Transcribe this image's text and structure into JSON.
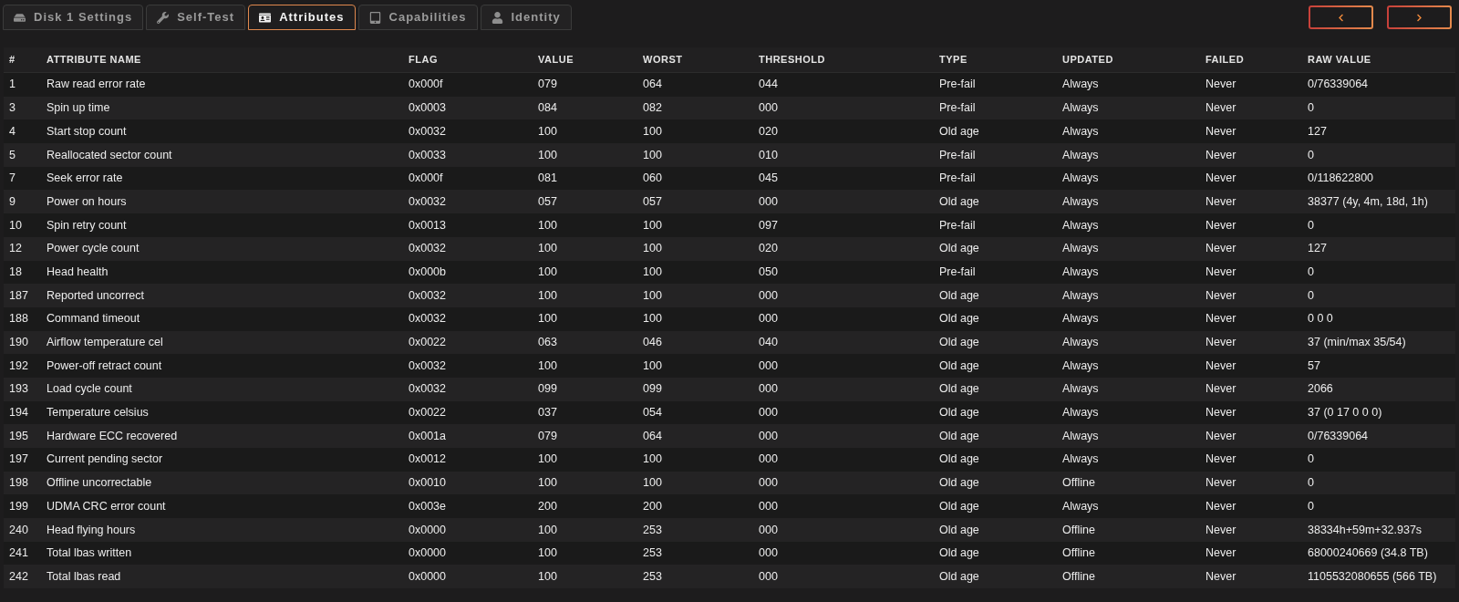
{
  "tabs": [
    {
      "label": "Disk 1 Settings",
      "selected": false
    },
    {
      "label": "Self-Test",
      "selected": false
    },
    {
      "label": "Attributes",
      "selected": true
    },
    {
      "label": "Capabilities",
      "selected": false
    },
    {
      "label": "Identity",
      "selected": false
    }
  ],
  "table": {
    "columns": [
      "#",
      "ATTRIBUTE NAME",
      "FLAG",
      "VALUE",
      "WORST",
      "THRESHOLD",
      "TYPE",
      "UPDATED",
      "FAILED",
      "RAW VALUE"
    ],
    "rows": [
      [
        "1",
        "Raw read error rate",
        "0x000f",
        "079",
        "064",
        "044",
        "Pre-fail",
        "Always",
        "Never",
        "0/76339064"
      ],
      [
        "3",
        "Spin up time",
        "0x0003",
        "084",
        "082",
        "000",
        "Pre-fail",
        "Always",
        "Never",
        "0"
      ],
      [
        "4",
        "Start stop count",
        "0x0032",
        "100",
        "100",
        "020",
        "Old age",
        "Always",
        "Never",
        "127"
      ],
      [
        "5",
        "Reallocated sector count",
        "0x0033",
        "100",
        "100",
        "010",
        "Pre-fail",
        "Always",
        "Never",
        "0"
      ],
      [
        "7",
        "Seek error rate",
        "0x000f",
        "081",
        "060",
        "045",
        "Pre-fail",
        "Always",
        "Never",
        "0/118622800"
      ],
      [
        "9",
        "Power on hours",
        "0x0032",
        "057",
        "057",
        "000",
        "Old age",
        "Always",
        "Never",
        "38377 (4y, 4m, 18d, 1h)"
      ],
      [
        "10",
        "Spin retry count",
        "0x0013",
        "100",
        "100",
        "097",
        "Pre-fail",
        "Always",
        "Never",
        "0"
      ],
      [
        "12",
        "Power cycle count",
        "0x0032",
        "100",
        "100",
        "020",
        "Old age",
        "Always",
        "Never",
        "127"
      ],
      [
        "18",
        "Head health",
        "0x000b",
        "100",
        "100",
        "050",
        "Pre-fail",
        "Always",
        "Never",
        "0"
      ],
      [
        "187",
        "Reported uncorrect",
        "0x0032",
        "100",
        "100",
        "000",
        "Old age",
        "Always",
        "Never",
        "0"
      ],
      [
        "188",
        "Command timeout",
        "0x0032",
        "100",
        "100",
        "000",
        "Old age",
        "Always",
        "Never",
        "0 0 0"
      ],
      [
        "190",
        "Airflow temperature cel",
        "0x0022",
        "063",
        "046",
        "040",
        "Old age",
        "Always",
        "Never",
        "37 (min/max 35/54)"
      ],
      [
        "192",
        "Power-off retract count",
        "0x0032",
        "100",
        "100",
        "000",
        "Old age",
        "Always",
        "Never",
        "57"
      ],
      [
        "193",
        "Load cycle count",
        "0x0032",
        "099",
        "099",
        "000",
        "Old age",
        "Always",
        "Never",
        "2066"
      ],
      [
        "194",
        "Temperature celsius",
        "0x0022",
        "037",
        "054",
        "000",
        "Old age",
        "Always",
        "Never",
        "37 (0 17 0 0 0)"
      ],
      [
        "195",
        "Hardware ECC recovered",
        "0x001a",
        "079",
        "064",
        "000",
        "Old age",
        "Always",
        "Never",
        "0/76339064"
      ],
      [
        "197",
        "Current pending sector",
        "0x0012",
        "100",
        "100",
        "000",
        "Old age",
        "Always",
        "Never",
        "0"
      ],
      [
        "198",
        "Offline uncorrectable",
        "0x0010",
        "100",
        "100",
        "000",
        "Old age",
        "Offline",
        "Never",
        "0"
      ],
      [
        "199",
        "UDMA CRC error count",
        "0x003e",
        "200",
        "200",
        "000",
        "Old age",
        "Always",
        "Never",
        "0"
      ],
      [
        "240",
        "Head flying hours",
        "0x0000",
        "100",
        "253",
        "000",
        "Old age",
        "Offline",
        "Never",
        "38334h+59m+32.937s"
      ],
      [
        "241",
        "Total lbas written",
        "0x0000",
        "100",
        "253",
        "000",
        "Old age",
        "Offline",
        "Never",
        "68000240669 (34.8 TB)"
      ],
      [
        "242",
        "Total lbas read",
        "0x0000",
        "100",
        "253",
        "000",
        "Old age",
        "Offline",
        "Never",
        "1105532080655 (566 TB)"
      ]
    ]
  }
}
